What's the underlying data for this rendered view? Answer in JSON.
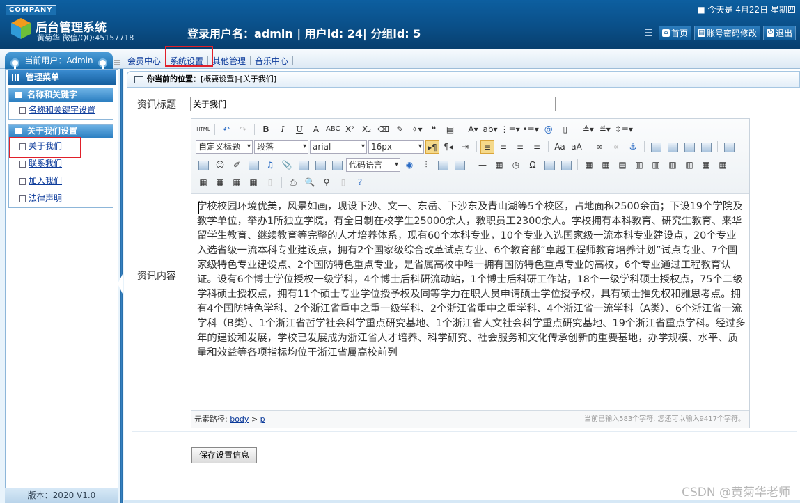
{
  "header": {
    "company": "COMPANY",
    "today": "■ 今天是 4月22日 星期四",
    "system_title": "后台管理系统",
    "author": "黄菊华 微信/QQ:45157718",
    "login_info": "登录用户名：admin | 用户id: 24| 分组id: 5",
    "links": [
      {
        "label": "首页",
        "icon": "home-icon"
      },
      {
        "label": "账号密码修改",
        "icon": "account-icon"
      },
      {
        "label": "退出",
        "icon": "power-icon"
      }
    ]
  },
  "current_user": "当前用户：Admin",
  "nav_tabs": [
    "会员中心",
    "系统设置",
    "其他管理",
    "音乐中心"
  ],
  "sidebar": {
    "title": "管理菜单",
    "groups": [
      {
        "title": "名称和关键字",
        "items": [
          "名称和关键字设置"
        ]
      },
      {
        "title": "关于我们设置",
        "items": [
          "关于我们",
          "联系我们",
          "加入我们",
          "法律声明"
        ]
      }
    ],
    "version": "版本：2020 V1.0"
  },
  "breadcrumb": {
    "label": "你当前的位置：",
    "path": "[概要设置]-[关于我们]"
  },
  "form": {
    "title_label": "资讯标题",
    "title_value": "关于我们",
    "content_label": "资讯内容",
    "save_button": "保存设置信息"
  },
  "editor": {
    "html_button": "HTML",
    "heading_select": "自定义标题",
    "paragraph_select": "段落",
    "font_select": "arial",
    "size_select": "16px",
    "code_select": "代码语言",
    "content": "学校校园环境优美，风景如画，现设下沙、文一、东岳、下沙东及青山湖等5个校区，占地面积2500余亩；下设19个学院及教学单位，举办1所独立学院，有全日制在校学生25000余人，教职员工2300余人。学校拥有本科教育、研究生教育、来华留学生教育、继续教育等完整的人才培养体系，现有60个本科专业，10个专业入选国家级一流本科专业建设点，20个专业入选省级一流本科专业建设点，拥有2个国家级综合改革试点专业、6个教育部“卓越工程师教育培养计划”试点专业、7个国家级特色专业建设点、2个国防特色重点专业，是省属高校中唯一拥有国防特色重点专业的高校，6个专业通过工程教育认证。设有6个博士学位授权一级学科，4个博士后科研流动站，1个博士后科研工作站，18个一级学科硕士授权点，75个二级学科硕士授权点，拥有11个硕士专业学位授予权及同等学力在职人员申请硕士学位授予权，具有硕士推免权和雅思考点。拥有4个国防特色学科、2个浙江省重中之重一级学科、2个浙江省重中之重学科、4个浙江省一流学科（A类）、6个浙江省一流学科（B类）、1个浙江省哲学社会科学重点研究基地、1个浙江省人文社会科学重点研究基地、19个浙江省重点学科。经过多年的建设和发展，学校已发展成为浙江省人才培养、科学研究、社会服务和文化传承创新的重要基地，办学规模、水平、质量和效益等各项指标均位于浙江省属高校前列",
    "path_label": "元素路径:",
    "path_body": "body",
    "path_sep": ">",
    "path_p": "p",
    "char_count": "当前已输入583个字符, 您还可以输入9417个字符。"
  },
  "watermark": "CSDN @黄菊华老师",
  "colors": {
    "header_bg": "#0a4f88",
    "highlight_border": "#e0202a",
    "link": "#0b3a9a"
  }
}
